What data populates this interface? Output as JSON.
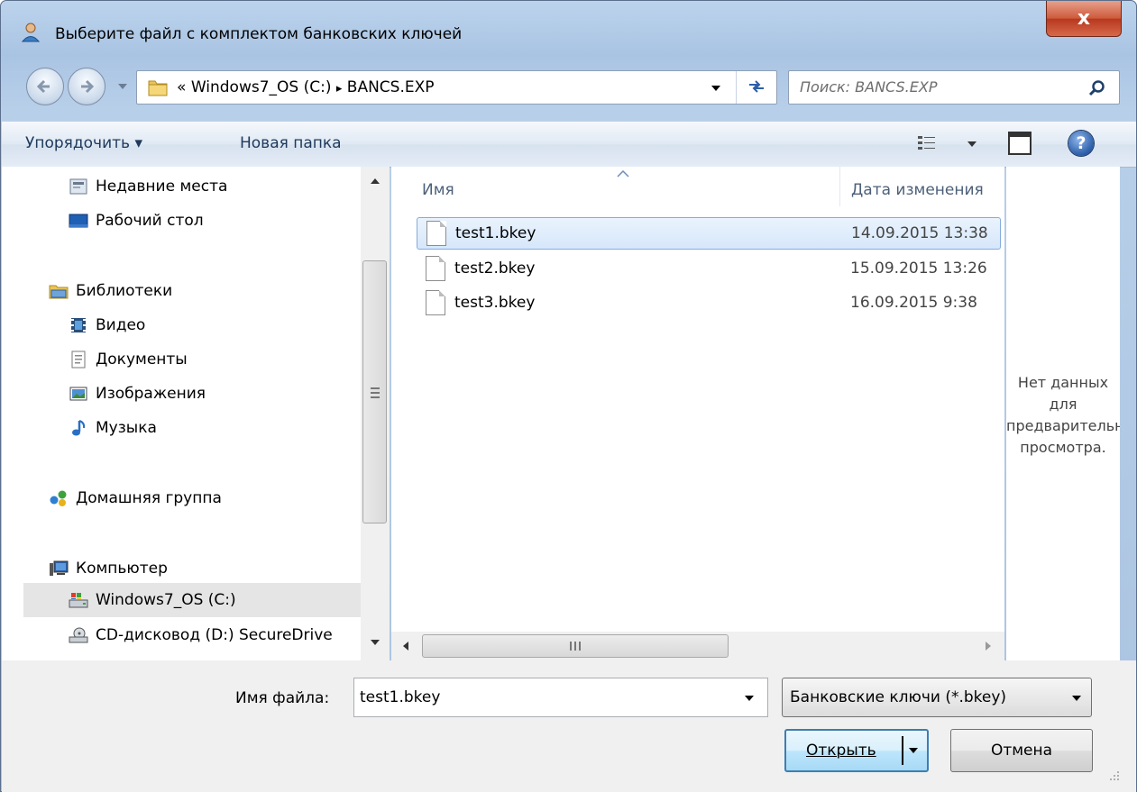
{
  "window": {
    "title": "Выберите файл с комплектом банковских ключей",
    "close_label": "x"
  },
  "navigation": {
    "address_prefix": "«",
    "path": [
      "Windows7_OS (C:)",
      "BANCS.EXP"
    ],
    "path_separator": "▸",
    "search_placeholder": "Поиск: BANCS.EXP"
  },
  "toolbar": {
    "organize_label": "Упорядочить ▾",
    "new_folder_label": "Новая папка"
  },
  "nav_pane": {
    "items": [
      {
        "label": "Недавние места",
        "icon": "recent-places-icon"
      },
      {
        "label": "Рабочий стол",
        "icon": "desktop-icon"
      },
      {
        "label": "Библиотеки",
        "icon": "libraries-icon"
      },
      {
        "label": "Видео",
        "icon": "video-icon"
      },
      {
        "label": "Документы",
        "icon": "documents-icon"
      },
      {
        "label": "Изображения",
        "icon": "pictures-icon"
      },
      {
        "label": "Музыка",
        "icon": "music-icon"
      },
      {
        "label": "Домашняя группа",
        "icon": "homegroup-icon"
      },
      {
        "label": "Компьютер",
        "icon": "computer-icon"
      },
      {
        "label": "Windows7_OS (C:)",
        "icon": "drive-icon",
        "selected": true
      },
      {
        "label": "CD-дисковод (D:) SecureDrive",
        "icon": "cd-drive-icon"
      }
    ]
  },
  "file_list": {
    "columns": [
      "Имя",
      "Дата изменения"
    ],
    "files": [
      {
        "name": "test1.bkey",
        "date": "14.09.2015 13:38",
        "selected": true
      },
      {
        "name": "test2.bkey",
        "date": "15.09.2015 13:26"
      },
      {
        "name": "test3.bkey",
        "date": "16.09.2015 9:38"
      }
    ]
  },
  "preview": {
    "line1": "Нет данных",
    "line2": "для",
    "line3": "предварительного",
    "line4": "просмотра."
  },
  "bottom": {
    "filename_label": "Имя файла:",
    "filename_value": "test1.bkey",
    "filter_value": "Банковские ключи (*.bkey)",
    "open_label": "Открыть",
    "cancel_label": "Отмена"
  },
  "colors": {
    "selection_border": "#84acdd",
    "selection_fill": "#d6e7fa",
    "close_button": "#c7432a",
    "open_button_border": "#3c7fb1"
  }
}
